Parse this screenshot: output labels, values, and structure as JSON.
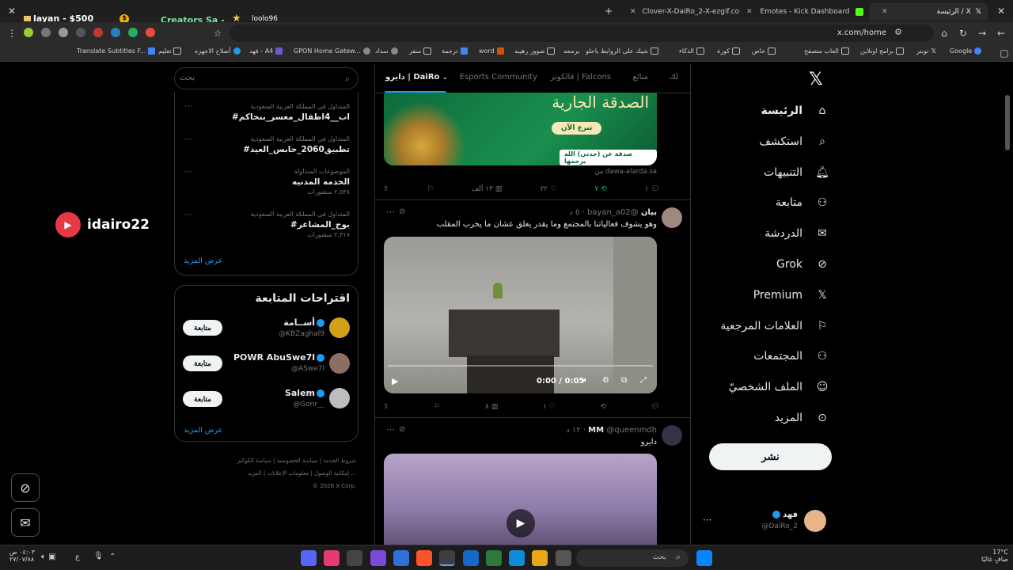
{
  "browser": {
    "tabs": [
      {
        "title": "الرئيسة / X"
      },
      {
        "title": "Emotes - Kick Dashboard"
      },
      {
        "title": "Clover-X-DaiRo_2-X-ezgif.com"
      }
    ],
    "stream_overlay": {
      "donor": "layan - $500",
      "creator": "Creators Sa -",
      "user": "loolo96"
    },
    "url": "x.com/home",
    "bookmarks": [
      "Google",
      "تويتر",
      "برامج اونلاين",
      "العاب متصفح",
      "خاص",
      "كورة",
      "الذكاء",
      "شيك على الروابط ياحلو",
      "برمجه",
      "صوور رهيبه",
      "word",
      "ترجمة",
      "سفر",
      "سداد",
      "GPON Home Gatew...",
      "فهد - A4",
      "أصلاح الاجهزه",
      "تعليم",
      "Translate Subtitles F..."
    ]
  },
  "streamer_tag": "idairo22",
  "nav": {
    "items": [
      {
        "label": "الرئيسة",
        "icon": "home-icon"
      },
      {
        "label": "استكشف",
        "icon": "search-icon"
      },
      {
        "label": "التنبيهات",
        "icon": "bell-icon"
      },
      {
        "label": "متابعة",
        "icon": "add-person-icon"
      },
      {
        "label": "الدردشة",
        "icon": "mail-icon"
      },
      {
        "label": "Grok",
        "icon": "grok-icon"
      },
      {
        "label": "Premium",
        "icon": "x-logo-icon"
      },
      {
        "label": "العلامات المرجعية",
        "icon": "bookmark-icon"
      },
      {
        "label": "المجتمعات",
        "icon": "communities-icon"
      },
      {
        "label": "الملف الشخصيّ",
        "icon": "profile-icon"
      },
      {
        "label": "المزيد",
        "icon": "more-icon"
      }
    ],
    "post_label": "نشر",
    "account": {
      "name": "فهد",
      "handle": "@DaiRo_2"
    }
  },
  "feed": {
    "tabs": [
      "لك",
      "متابَع",
      "فالكونز | Falcons",
      "Esports Community",
      "دايرو | DaiRo"
    ],
    "tweet1": {
      "banner_title": "الصدقة الجارية",
      "banner_button": "تبرع الآن",
      "banner_caption": "صدقة عن (جدتي) الله يرحمها",
      "source": "من dawa-alarda.sa",
      "replies": "١",
      "retweets": "٧",
      "likes": "٢٢",
      "views": "١٣ ألف"
    },
    "tweet2": {
      "name": "بيان",
      "handle": "@bayan_a02",
      "time": "٥ د",
      "text": "وهو يشوف فعالياتنا بالمجتمع وما يقدر يعلق عشان ما يخرب المقلب",
      "video_time": "0:00 / 0:05",
      "replies": "",
      "retweets": "",
      "likes": "١",
      "views": "٨"
    },
    "tweet3": {
      "name": "MM",
      "handle": "@queenmdh",
      "time": "١٢ د",
      "text": "دايرو"
    }
  },
  "sidebar": {
    "search_placeholder": "بحث",
    "trends": [
      {
        "context": "المتداول في المملكة العربية السعودية",
        "title": "#اب__4اطفال_معسر_بنحاكم",
        "count": ""
      },
      {
        "context": "المتداول في المملكة العربية السعودية",
        "title": "#تطبيق2060_حابس_العيد",
        "count": ""
      },
      {
        "context": "الموضوعات المتداولة",
        "title": "الخدمه المدنيه",
        "count": "٢,٥٣٨ منشورات"
      },
      {
        "context": "المتداول في المملكة العربية السعودية",
        "title": "#بوح_المشاعر",
        "count": "٢,٣١٧ منشورات"
      }
    ],
    "show_more": "عرض المزيد",
    "who_to_follow_title": "اقتراحات المتابعة",
    "suggestions": [
      {
        "name": "أســامة",
        "handle": "@KBZaghal9",
        "button": "متابعة"
      },
      {
        "name": "POWR AbuSwe7l",
        "handle": "@ASwe7l",
        "button": "متابعة"
      },
      {
        "name": "Salem",
        "handle": "@Gonr__",
        "button": "متابعة"
      }
    ],
    "footer": [
      "شروط الخدمة",
      "سياسة الخصوصية",
      "سياسة الكوكيز",
      "إمكانية الوصول",
      "معلومات الإعلانات",
      "المزيد ...",
      "© 2026 X Corp."
    ]
  },
  "taskbar": {
    "search_placeholder": "بحث",
    "time": "٠٤:٠٣ ص",
    "date": "٢٧/٠٧/٨٨",
    "weather_temp": "17°C",
    "weather_desc": "صافٍ غالبًا",
    "lang": "ع"
  }
}
